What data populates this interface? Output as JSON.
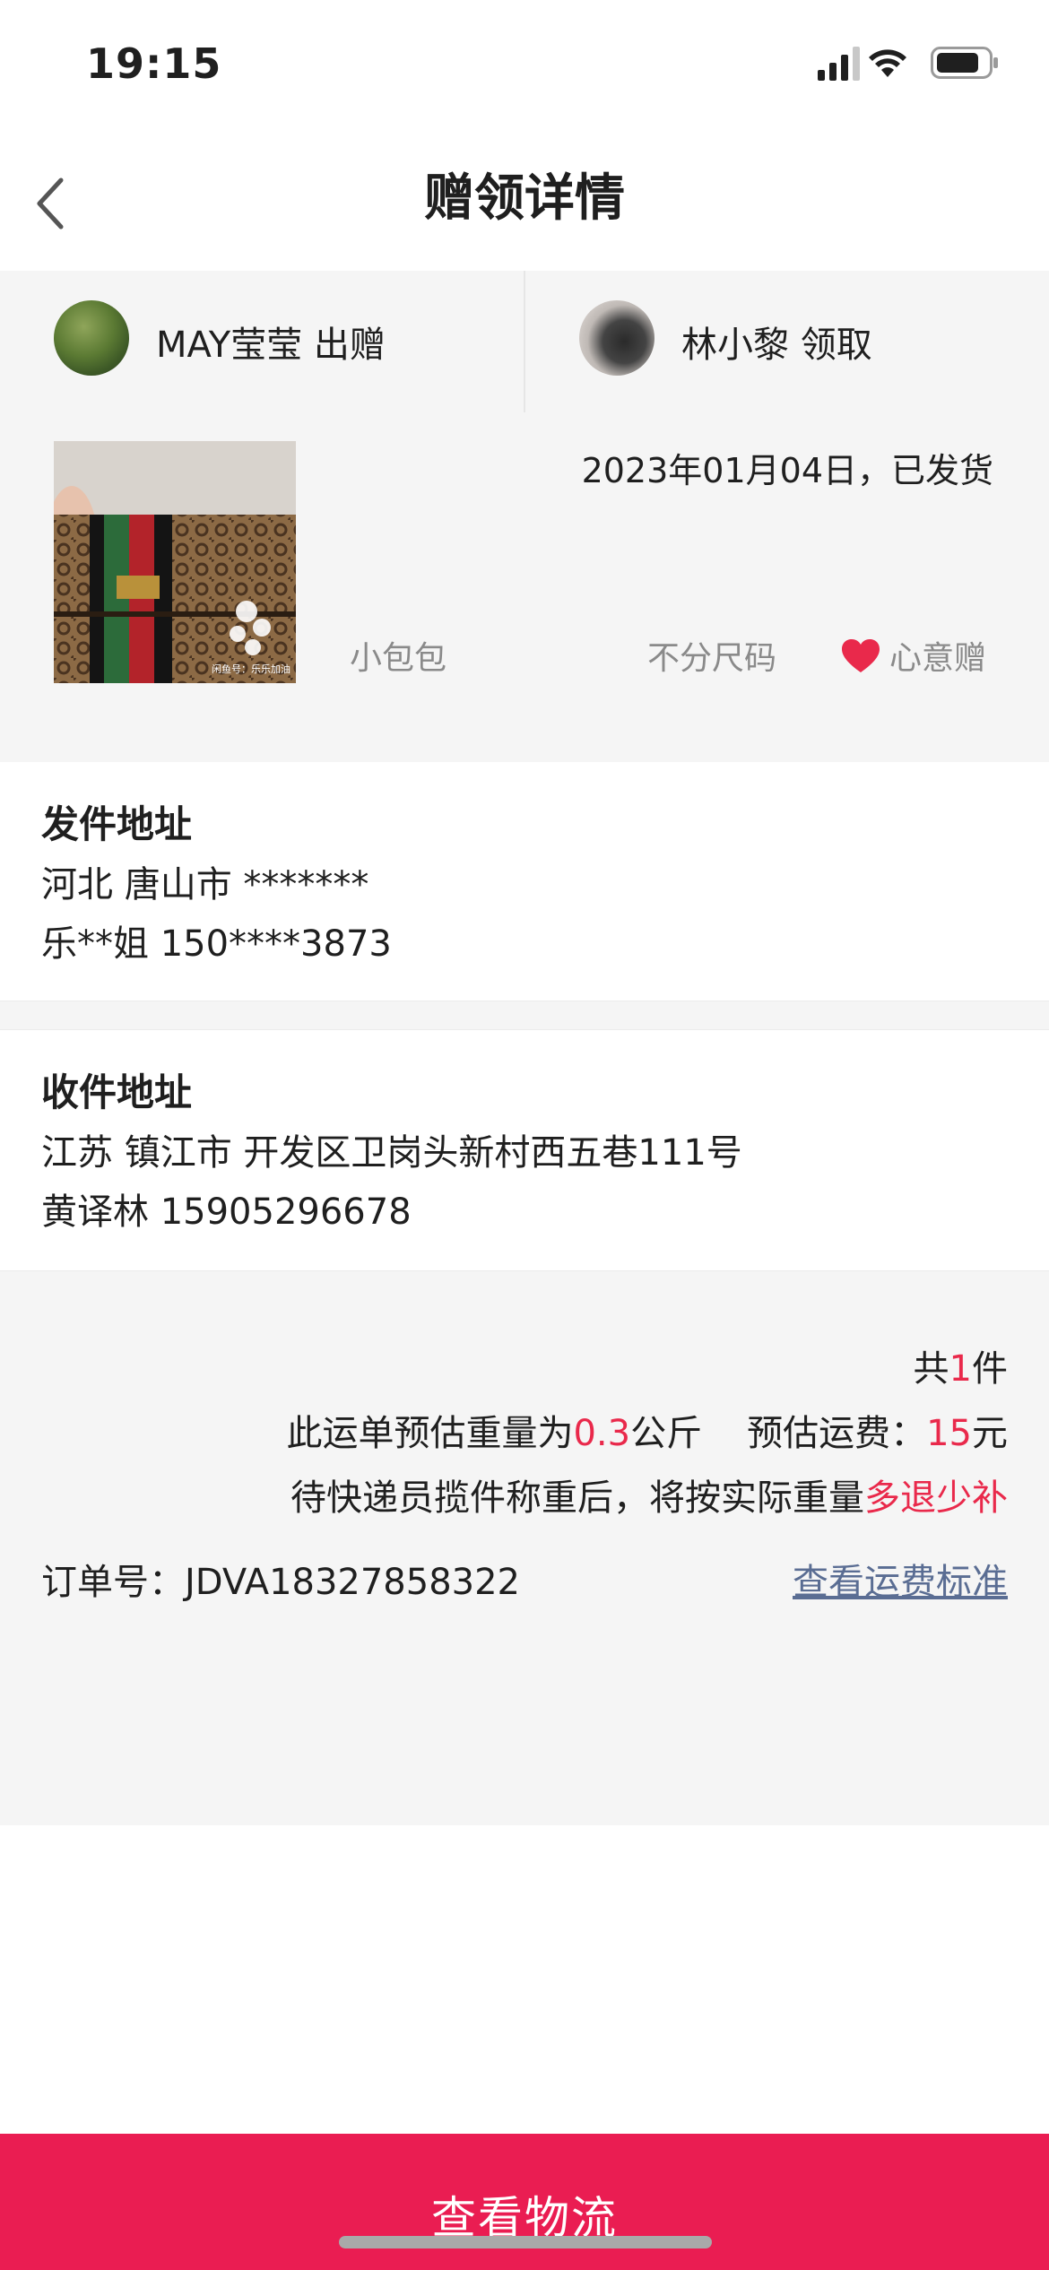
{
  "status_bar": {
    "time": "19:15"
  },
  "nav": {
    "title": "赠领详情",
    "back_icon": "chevron-left-icon"
  },
  "users": {
    "giver": {
      "name": "MAY莹莹",
      "action": "出赠"
    },
    "receiver": {
      "name": "林小黎",
      "action": "领取"
    }
  },
  "product": {
    "date_status": "2023年01月04日，已发货",
    "name": "小包包",
    "size": "不分尺码",
    "tag": "心意赠",
    "image_watermark": "闲鱼号：乐乐加油",
    "tag_color": "#e9294b"
  },
  "sender_address": {
    "title": "发件地址",
    "location": "河北 唐山市 *******",
    "contact": "乐**姐 150****3873"
  },
  "receiver_address": {
    "title": "收件地址",
    "location": "江苏 镇江市 开发区卫岗头新村西五巷111号",
    "contact": "黄译林 15905296678"
  },
  "summary": {
    "count_prefix": "共",
    "count": "1",
    "count_suffix": "件",
    "weight_prefix": "此运单预估重量为",
    "weight": "0.3",
    "weight_unit": "公斤",
    "fee_prefix": "预估运费：",
    "fee": "15",
    "fee_unit": "元",
    "note_prefix": "待快递员揽件称重后，将按实际重量",
    "note_highlight": "多退少补",
    "order_label": "订单号：",
    "order_no": "JDVA18327858322",
    "fee_link": "查看运费标准"
  },
  "bottom_button": {
    "label": "查看物流",
    "color": "#ea1d52"
  },
  "colors": {
    "accent_red": "#e9294b",
    "link_blue": "#5a6d93",
    "panel_gray": "#f5f5f5"
  }
}
